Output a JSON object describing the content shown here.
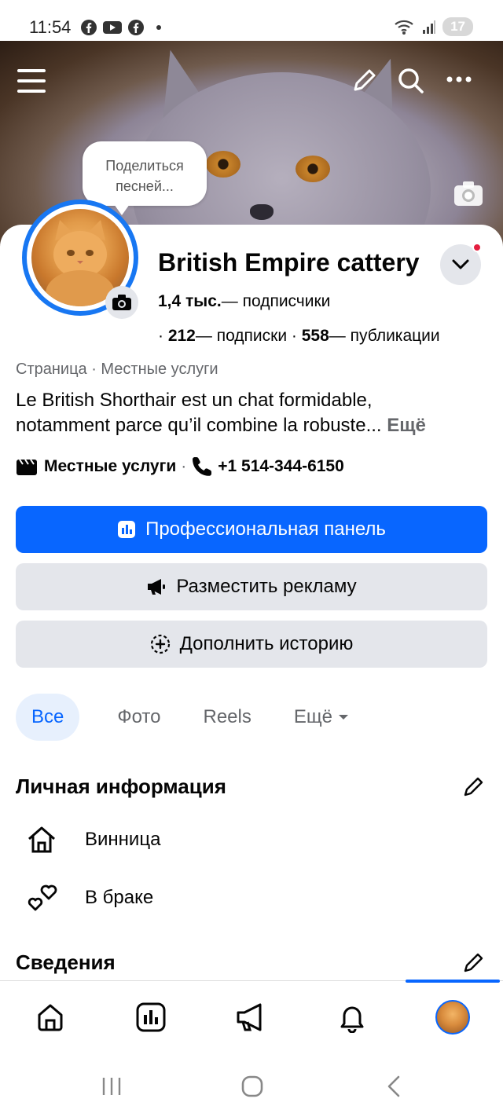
{
  "status_bar": {
    "time": "11:54",
    "battery": "17"
  },
  "cover": {
    "share_song_bubble": "Поделиться песней..."
  },
  "profile": {
    "name": "British Empire cattery",
    "followers_count": "1,4 тыс.",
    "followers_label": "— подписчики",
    "following_count": "212",
    "following_label": "— подписки",
    "posts_count": "558",
    "posts_label": "— публикации",
    "category": "Страница · Местные услуги",
    "bio_line1": "Le British Shorthair est un chat formidable,",
    "bio_line2": "notamment parce qu’il combine la robuste...",
    "bio_more": "Ещё",
    "contact_category": "Местные услуги",
    "phone": "+1 514-344-6150"
  },
  "buttons": {
    "professional_dashboard": "Профессиональная панель",
    "advertise": "Разместить рекламу",
    "add_story": "Дополнить историю"
  },
  "tabs": [
    {
      "label": "Все",
      "active": true
    },
    {
      "label": "Фото",
      "active": false
    },
    {
      "label": "Reels",
      "active": false
    },
    {
      "label": "Ещё",
      "active": false
    }
  ],
  "personal_info": {
    "title": "Личная информация",
    "city": "Винница",
    "relationship": "В браке"
  },
  "details": {
    "title": "Сведения"
  },
  "colors": {
    "accent": "#0866ff",
    "secondary_bg": "#e4e6eb",
    "muted_text": "#65676b"
  }
}
